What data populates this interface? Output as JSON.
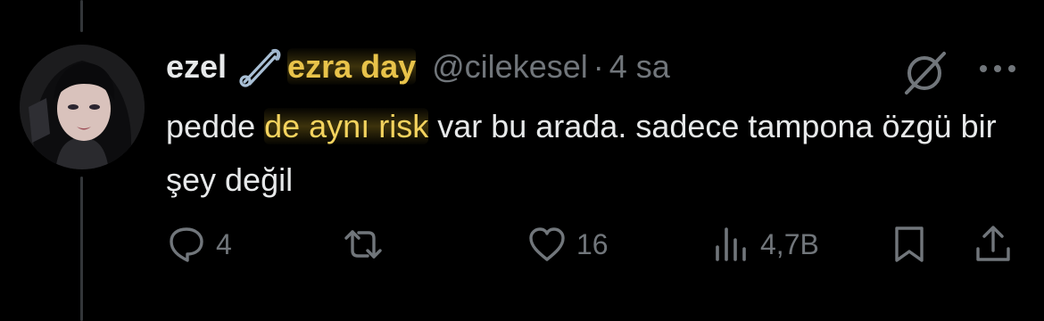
{
  "tweet": {
    "display_name": "ezel",
    "display_name_emoji": "safety-pin-icon",
    "display_name_highlighted": "ezra day",
    "handle": "@cilekesel",
    "separator": "·",
    "time": "4 sa",
    "text": {
      "before": "pedde ",
      "highlight": "de aynı risk",
      "after": " var bu arada. sadece tampona özgü bir şey değil"
    }
  },
  "actions": {
    "reply_count": "4",
    "retweet_count": "",
    "like_count": "16",
    "views_count": "4,7B"
  },
  "icons": {
    "top_right": [
      "grok-icon",
      "more-icon"
    ],
    "actions": [
      "reply-icon",
      "retweet-icon",
      "like-icon",
      "views-icon",
      "bookmark-icon",
      "share-icon"
    ]
  },
  "colors": {
    "background": "#000000",
    "primary_text": "#e7e9ea",
    "secondary_text": "#71767b",
    "highlight_text": "#f4d35e",
    "thread_line": "#333639"
  }
}
